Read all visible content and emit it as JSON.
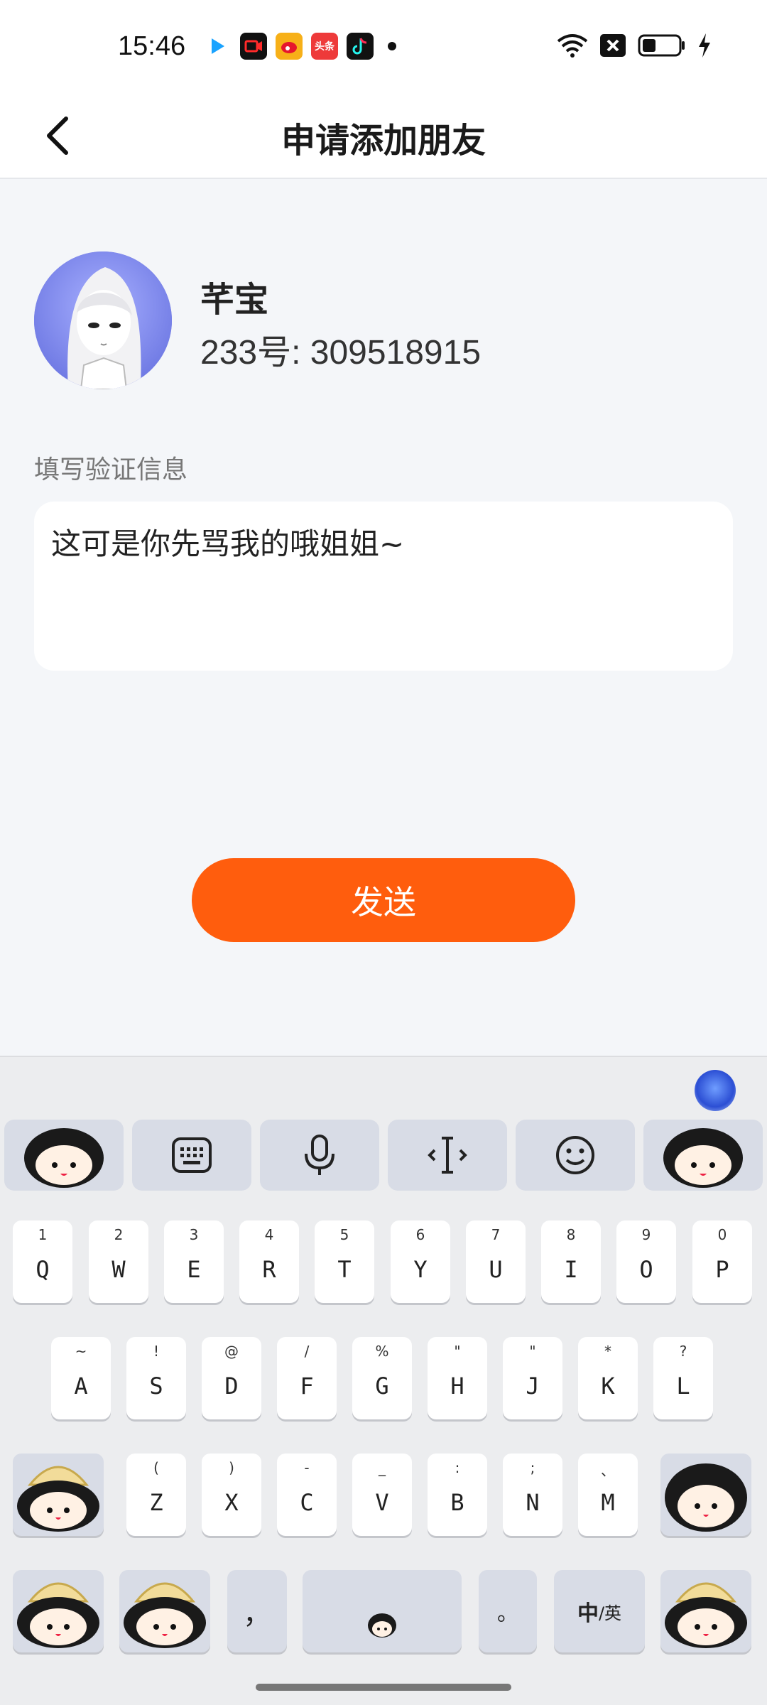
{
  "status_bar": {
    "time": "15:46",
    "app_icons": [
      "video-app-icon",
      "record-app-icon",
      "weibo-icon",
      "toutiao-icon",
      "douyin-icon"
    ],
    "toutiao_text": "头条",
    "right_icons": [
      "wifi-icon",
      "sim-off-icon",
      "battery-icon",
      "charging-icon"
    ]
  },
  "header": {
    "title": "申请添加朋友",
    "back_icon": "chevron-left-icon"
  },
  "profile": {
    "name": "芊宝",
    "id_line": "233号: 309518915"
  },
  "verification": {
    "label": "填写验证信息",
    "message": "这可是你先骂我的哦姐姐~"
  },
  "send_button": {
    "label": "发送",
    "color": "#ff5d0d"
  },
  "keyboard": {
    "tool_icons": [
      "sticker",
      "keyboard-icon",
      "microphone-icon",
      "text-cursor-icon",
      "smiley-icon",
      "sticker"
    ],
    "row1": [
      {
        "hint": "1",
        "key": "Q"
      },
      {
        "hint": "2",
        "key": "W"
      },
      {
        "hint": "3",
        "key": "E"
      },
      {
        "hint": "4",
        "key": "R"
      },
      {
        "hint": "5",
        "key": "T"
      },
      {
        "hint": "6",
        "key": "Y"
      },
      {
        "hint": "7",
        "key": "U"
      },
      {
        "hint": "8",
        "key": "I"
      },
      {
        "hint": "9",
        "key": "O"
      },
      {
        "hint": "0",
        "key": "P"
      }
    ],
    "row2": [
      {
        "hint": "~",
        "key": "A"
      },
      {
        "hint": "!",
        "key": "S"
      },
      {
        "hint": "@",
        "key": "D"
      },
      {
        "hint": "/",
        "key": "F"
      },
      {
        "hint": "%",
        "key": "G"
      },
      {
        "hint": "\"",
        "key": "H"
      },
      {
        "hint": "\"",
        "key": "J"
      },
      {
        "hint": "*",
        "key": "K"
      },
      {
        "hint": "?",
        "key": "L"
      }
    ],
    "row3": [
      {
        "hint": "(",
        "key": "Z"
      },
      {
        "hint": ")",
        "key": "X"
      },
      {
        "hint": "-",
        "key": "C"
      },
      {
        "hint": "_",
        "key": "V"
      },
      {
        "hint": ":",
        "key": "B"
      },
      {
        "hint": ";",
        "key": "N"
      },
      {
        "hint": "、",
        "key": "M"
      }
    ],
    "comma": "，",
    "period": "。",
    "lang_switch_main": "中",
    "lang_switch_sub": "/英"
  }
}
